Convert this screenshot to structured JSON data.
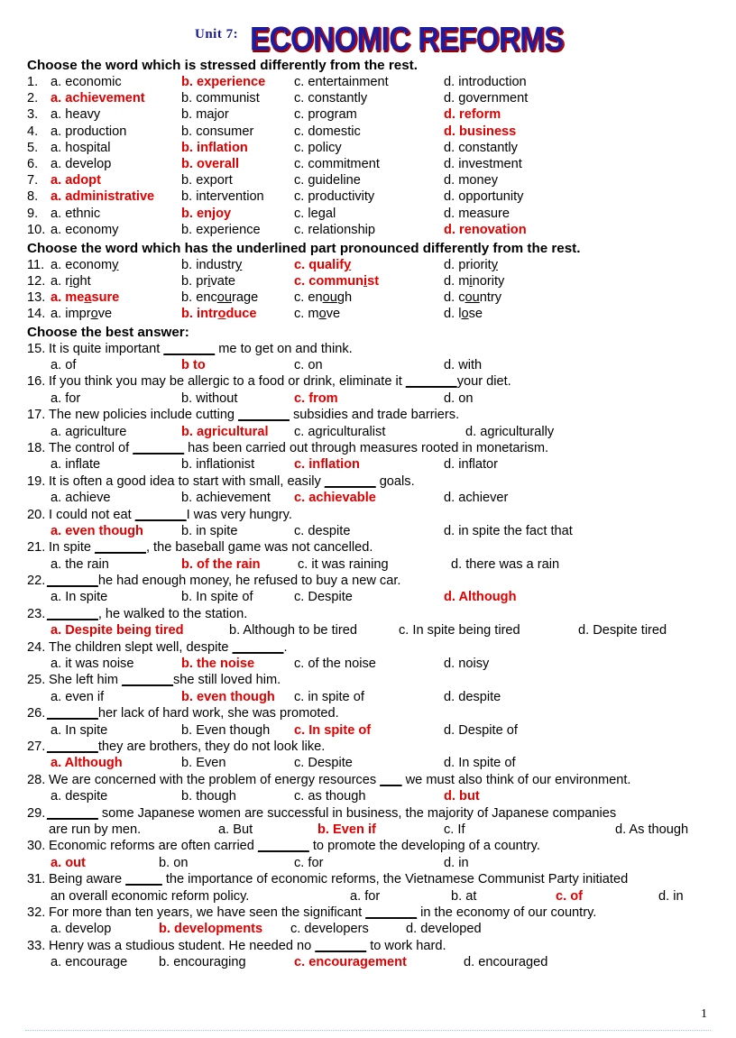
{
  "header": {
    "unit_label": "Unit 7:",
    "title": "ECONOMIC REFORMS",
    "title_color": "#1c1c9c",
    "accent_color": "#e00000"
  },
  "sections": {
    "stress": "Choose the word which is stressed differently from the rest.",
    "pronunciation": "Choose the word which has the underlined part pronounced differently from the rest.",
    "best_answer": "Choose the best answer:"
  },
  "stress_questions": [
    {
      "num": "1.",
      "a": "a. economic",
      "b": "b. experience",
      "c": "c. entertainment",
      "d": "d. introduction",
      "correct": "b"
    },
    {
      "num": "2.",
      "a": "a. achievement",
      "b": "b. communist",
      "c": "c. constantly",
      "d": "d. government",
      "correct": "a"
    },
    {
      "num": "3.",
      "a": "a. heavy",
      "b": "b. major",
      "c": "c. program",
      "d": "d. reform",
      "correct": "d"
    },
    {
      "num": "4.",
      "a": "a. production",
      "b": "b. consumer",
      "c": "c. domestic",
      "d": "d. business",
      "correct": "d"
    },
    {
      "num": "5.",
      "a": "a. hospital",
      "b": "b. inflation",
      "c": "c. policy",
      "d": "d. constantly",
      "correct": "b"
    },
    {
      "num": "6.",
      "a": "a. develop",
      "b": "b. overall",
      "c": "c. commitment",
      "d": "d. investment",
      "correct": "b"
    },
    {
      "num": "7.",
      "a": "a. adopt",
      "b": "b. export",
      "c": "c. guideline",
      "d": "d. money",
      "correct": "a"
    },
    {
      "num": "8.",
      "a": "a. administrative",
      "b": "b. intervention",
      "c": "c. productivity",
      "d": "d. opportunity",
      "correct": "a"
    },
    {
      "num": "9.",
      "a": "a. ethnic",
      "b": "b. enjoy",
      "c": "c. legal",
      "d": "d. measure",
      "correct": "b"
    },
    {
      "num": "10.",
      "a": "a. economy",
      "b": "b. experience",
      "c": "c. relationship",
      "d": "d. renovation",
      "correct": "d"
    }
  ],
  "pronunciation_questions": [
    {
      "num": "11.",
      "a": {
        "pre": "a. econom",
        "mid": "y",
        "post": ""
      },
      "b": {
        "pre": "b. industr",
        "mid": "y",
        "post": ""
      },
      "c": {
        "pre": "c. qualif",
        "mid": "y",
        "post": ""
      },
      "d": {
        "pre": "d. priorit",
        "mid": "y",
        "post": ""
      },
      "correct": "c"
    },
    {
      "num": "12.",
      "a": {
        "pre": "a. r",
        "mid": "i",
        "post": "ght"
      },
      "b": {
        "pre": "b. pr",
        "mid": "i",
        "post": "vate"
      },
      "c": {
        "pre": "c. commun",
        "mid": "i",
        "post": "st"
      },
      "d": {
        "pre": "d. m",
        "mid": "i",
        "post": "nority"
      },
      "correct": "c"
    },
    {
      "num": "13.",
      "a": {
        "pre": "a. me",
        "mid": "a",
        "post": "sure"
      },
      "b": {
        "pre": "b. enc",
        "mid": "ou",
        "post": "rage"
      },
      "c": {
        "pre": "c. en",
        "mid": "ou",
        "post": "gh"
      },
      "d": {
        "pre": "d. c",
        "mid": "ou",
        "post": "ntry"
      },
      "correct": "a"
    },
    {
      "num": "14.",
      "a": {
        "pre": "a. impr",
        "mid": "o",
        "post": "ve"
      },
      "b": {
        "pre": "b. intr",
        "mid": "o",
        "post": "duce"
      },
      "c": {
        "pre": "c. m",
        "mid": "o",
        "post": "ve"
      },
      "d": {
        "pre": "d. l",
        "mid": "o",
        "post": "se"
      },
      "correct": "b"
    }
  ],
  "best_answer_questions": [
    {
      "num": "15.",
      "stem_pre": "It is quite important ",
      "blank": "_______",
      "stem_post": " me to get on and think.",
      "a": "a. of",
      "b": "b to",
      "c": "c. on",
      "d": "d. with",
      "correct": "b",
      "variant": ""
    },
    {
      "num": "16.",
      "stem_pre": "If you think you may be allergic to a food or drink, eliminate it ",
      "blank": "_______",
      "stem_post": "your diet.",
      "a": "a. for",
      "b": "b. without",
      "c": "c. from",
      "d": "d. on",
      "correct": "c",
      "variant": ""
    },
    {
      "num": "17.",
      "stem_pre": "The new policies include cutting ",
      "blank": "_______",
      "stem_post": " subsidies and trade barriers.",
      "a": "a. agriculture",
      "b": "b. agricultural",
      "c": "c. agriculturalist",
      "d": "d. agriculturally",
      "correct": "b",
      "variant": "v17"
    },
    {
      "num": "18.",
      "stem_pre": "The control of ",
      "blank": "_______",
      "stem_post": " has been carried out through  measures rooted in monetarism.",
      "a": "a. inflate",
      "b": "b. inflationist",
      "c": "c. inflation",
      "d": "d. inflator",
      "correct": "c",
      "variant": ""
    },
    {
      "num": "19.",
      "stem_pre": "It is often a good idea to start with small, easily ",
      "blank": "_______",
      "stem_post": " goals.",
      "a": "a. achieve",
      "b": "b. achievement",
      "c": "c. achievable",
      "d": "d. achiever",
      "correct": "c",
      "variant": ""
    },
    {
      "num": "20.",
      "stem_pre": "I could not eat ",
      "blank": "_______",
      "stem_post": "I was very hungry.",
      "a": "a. even though",
      "b": "b. in spite",
      "c": "c. despite",
      "d": "d. in spite the fact that",
      "correct": "a",
      "variant": "v20"
    },
    {
      "num": "21.",
      "stem_pre": "In spite ",
      "blank": "_______",
      "stem_post": ", the baseball game was not cancelled.",
      "a": "a. the rain",
      "b": "b. of the rain",
      "c": "c. it was raining",
      "d": "d. there was a rain",
      "correct": "b",
      "variant": "v21"
    },
    {
      "num": "22.",
      "stem_pre": "",
      "blank": "_______",
      "stem_post": "he had enough money, he refused to buy a new car.",
      "a": "a. In spite",
      "b": "b. In spite of",
      "c": "c. Despite",
      "d": "d. Although",
      "correct": "d",
      "variant": ""
    },
    {
      "num": "23.",
      "stem_pre": "",
      "blank": "_______",
      "stem_post": ", he walked to the station.",
      "a": "a. Despite being tired",
      "b": "b. Although to be tired",
      "c": "c. In spite being tired",
      "d": "d. Despite tired",
      "correct": "a",
      "variant": "v23"
    },
    {
      "num": "24.",
      "stem_pre": "The children slept well, despite ",
      "blank": "_______",
      "stem_post": ".",
      "a": "a. it was noise",
      "b": "b. the noise",
      "c": "c. of the noise",
      "d": "d. noisy",
      "correct": "b",
      "variant": ""
    },
    {
      "num": "25.",
      "stem_pre": "She left him ",
      "blank": "_______",
      "stem_post": "she still loved him.",
      "a": "a. even if",
      "b": "b. even though",
      "c": "c. in spite of",
      "d": "d. despite",
      "correct": "b",
      "variant": ""
    },
    {
      "num": "26.",
      "stem_pre": "",
      "blank": "_______",
      "stem_post": "her lack of hard work, she was promoted.",
      "a": "a. In spite",
      "b": "b. Even though",
      "c": "c. In spite of",
      "d": "d. Despite of",
      "correct": "c",
      "variant": ""
    },
    {
      "num": "27.",
      "stem_pre": "",
      "blank": "_______",
      "stem_post": "they are brothers, they do not look like.",
      "a": "a. Although",
      "b": "b. Even",
      "c": "c. Despite",
      "d": "d. In spite of",
      "correct": "a",
      "variant": ""
    },
    {
      "num": "28.",
      "stem_pre": "We are concerned with the problem of energy resources ",
      "blank": "___",
      "stem_post": " we must also think of our environment.",
      "a": "a. despite",
      "b": "b. though",
      "c": "c. as though",
      "d": "d. but",
      "correct": "d",
      "variant": ""
    },
    {
      "num": "29.",
      "stem_pre": "",
      "blank": "_______",
      "stem_post": " some Japanese women are successful in business, the majority of Japanese companies",
      "cont": "are run by men.",
      "a": "a. But",
      "b": "b. Even if",
      "c": "c. If",
      "d": "d. As though",
      "correct": "b",
      "variant": "v29"
    },
    {
      "num": "30.",
      "stem_pre": "Economic reforms are often carried ",
      "blank": "_______",
      "stem_post": " to promote the developing of a country.",
      "a": "a. out",
      "b": "b. on",
      "c": "c. for",
      "d": "d. in",
      "correct": "a",
      "variant": "v30"
    },
    {
      "num": "31.",
      "stem_pre": "Being aware ",
      "blank": "_____",
      "stem_post": " the importance of economic reforms, the Vietnamese Communist Party initiated",
      "cont": "an overall economic reform policy.",
      "a": "a. for",
      "b": "b. at",
      "c": "c. of",
      "d": "d. in",
      "correct": "c",
      "variant": "v31"
    },
    {
      "num": "32.",
      "stem_pre": "For more than ten years, we have seen the significant ",
      "blank": "_______",
      "stem_post": " in the economy of our country.",
      "a": "a. develop",
      "b": "b. developments",
      "c": "c. developers",
      "d": "d. developed",
      "correct": "b",
      "variant": "v32"
    },
    {
      "num": "33.",
      "stem_pre": "Henry was a studious student. He needed no ",
      "blank": "_______",
      "stem_post": " to work hard.",
      "a": "a. encourage",
      "b": "b. encouraging",
      "c": "c. encouragement",
      "d": "d. encouraged",
      "correct": "c",
      "variant": "v33"
    }
  ],
  "footer": {
    "page_number": "1"
  }
}
